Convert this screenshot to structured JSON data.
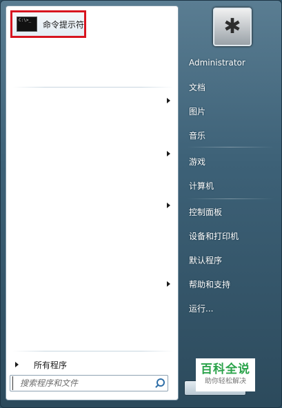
{
  "pinned": {
    "label": "命令提示符",
    "icon": "cmd-icon",
    "icon_text": "C:\\>_"
  },
  "all_programs": {
    "label": "所有程序"
  },
  "search": {
    "placeholder": "搜索程序和文件"
  },
  "user": {
    "name": "Administrator",
    "avatar_icon": "avatar-icon"
  },
  "right_items": [
    "文档",
    "图片",
    "音乐",
    "游戏",
    "计算机",
    "控制面板",
    "设备和打印机",
    "默认程序",
    "帮助和支持",
    "运行..."
  ],
  "watermark": {
    "title": "百科全说",
    "subtitle": "助你轻松解决"
  },
  "colors": {
    "highlight_border": "#d7141f",
    "watermark_green": "#2aa34a"
  }
}
